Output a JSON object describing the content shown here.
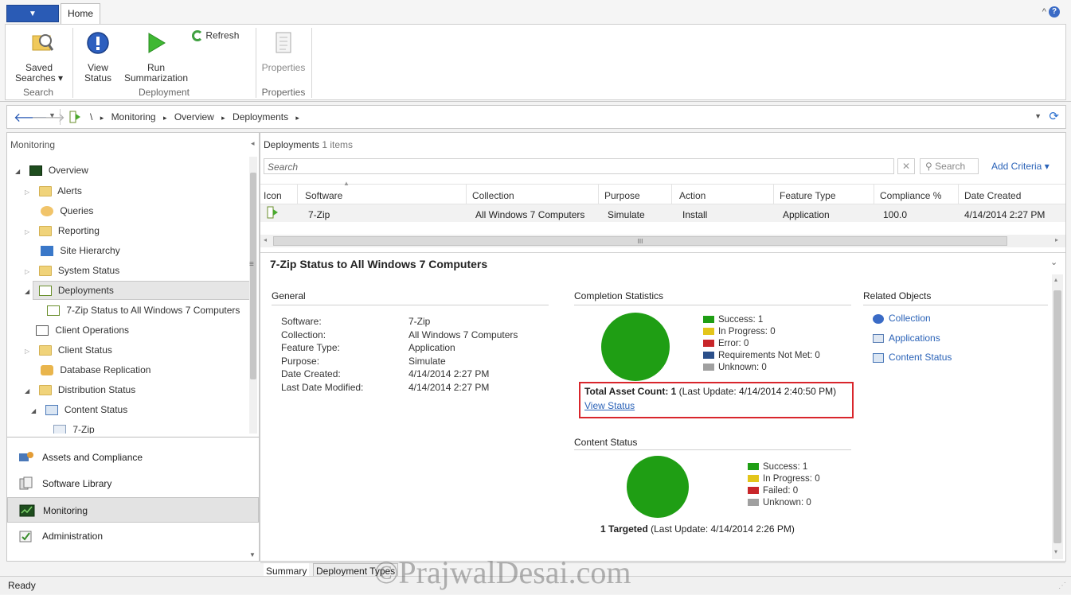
{
  "ribbon": {
    "tab_home": "Home",
    "saved_searches": "Saved Searches ▾",
    "view_status": "View Status",
    "run_summarization": "Run Summarization",
    "refresh": "Refresh",
    "properties": "Properties",
    "group_search": "Search",
    "group_deployment": "Deployment",
    "group_properties": "Properties"
  },
  "address": {
    "root": "\\",
    "items": [
      "Monitoring",
      "Overview",
      "Deployments"
    ]
  },
  "nav": {
    "title": "Monitoring",
    "tree": {
      "overview": "Overview",
      "alerts": "Alerts",
      "queries": "Queries",
      "reporting": "Reporting",
      "site_hierarchy": "Site Hierarchy",
      "system_status": "System Status",
      "deployments": "Deployments",
      "deployment_child": "7-Zip Status to All Windows 7 Computers",
      "client_operations": "Client Operations",
      "client_status": "Client Status",
      "database_replication": "Database Replication",
      "distribution_status": "Distribution Status",
      "content_status": "Content Status",
      "seven_zip": "7-Zip"
    },
    "workspaces": [
      "Assets and Compliance",
      "Software Library",
      "Monitoring",
      "Administration"
    ]
  },
  "list": {
    "title": "Deployments",
    "count": "1 items",
    "search_placeholder": "Search",
    "search_button": "Search",
    "add_criteria": "Add Criteria ▾",
    "columns": [
      "Icon",
      "Software",
      "Collection",
      "Purpose",
      "Action",
      "Feature Type",
      "Compliance %",
      "Date Created"
    ],
    "row": {
      "software": "7-Zip",
      "collection": "All Windows 7 Computers",
      "purpose": "Simulate",
      "action": "Install",
      "feature_type": "Application",
      "compliance": "100.0",
      "date_created": "4/14/2014 2:27 PM"
    },
    "scroll_grip": "III"
  },
  "details": {
    "title": "7-Zip Status to All Windows 7 Computers",
    "general": {
      "heading": "General",
      "keys": [
        "Software:",
        "Collection:",
        "Feature Type:",
        "Purpose:",
        "Date Created:",
        "Last Date Modified:"
      ],
      "values": [
        "7-Zip",
        "All Windows 7 Computers",
        "Application",
        "Simulate",
        "4/14/2014 2:27 PM",
        "4/14/2014 2:27 PM"
      ]
    },
    "completion": {
      "heading": "Completion Statistics",
      "legend": [
        "Success: 1",
        "In Progress: 0",
        "Error: 0",
        "Requirements Not Met: 0",
        "Unknown: 0"
      ],
      "total_bold": "Total Asset Count: 1",
      "total_rest": " (Last Update: 4/14/2014 2:40:50 PM)",
      "view_status": "View Status"
    },
    "content_status": {
      "heading": "Content Status",
      "legend": [
        "Success: 1",
        "In Progress: 0",
        "Failed: 0",
        "Unknown: 0"
      ],
      "targeted_bold": "1 Targeted",
      "targeted_rest": " (Last Update: 4/14/2014 2:26 PM)"
    },
    "related": {
      "heading": "Related Objects",
      "links": [
        "Collection",
        "Applications",
        "Content Status"
      ]
    },
    "tabs": [
      "Summary",
      "Deployment Types"
    ]
  },
  "colors": {
    "success": "#1f9e14",
    "in_progress": "#e3c51a",
    "error": "#c8262a",
    "req_not_met": "#2b4f8a",
    "unknown": "#a0a0a0",
    "highlight_box": "#d9262c",
    "link": "#2b63b8"
  },
  "status_bar": "Ready",
  "watermark": "©PrajwalDesai.com"
}
